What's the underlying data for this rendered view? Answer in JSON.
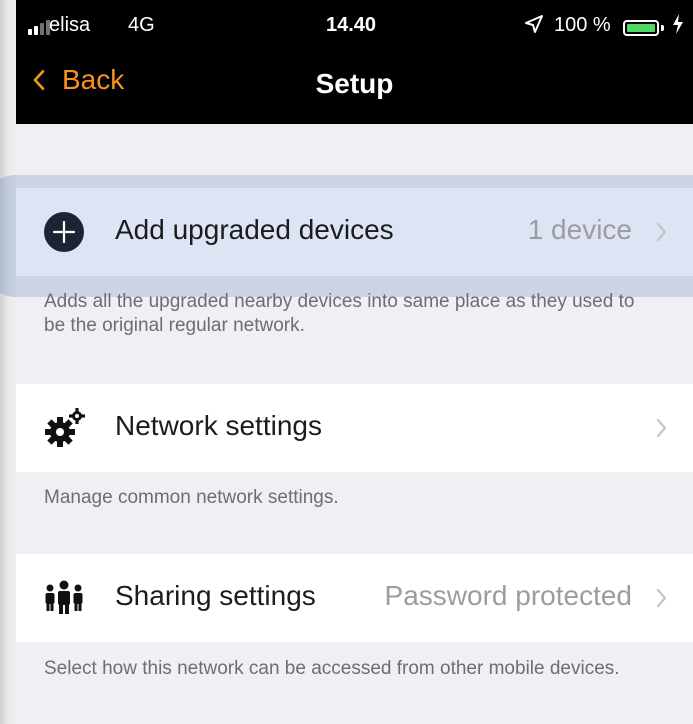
{
  "status_bar": {
    "carrier": "elisa",
    "network": "4G",
    "time": "14.40",
    "battery": "100 %",
    "battery_color": "#4cd964"
  },
  "nav": {
    "back_label": "Back",
    "title": "Setup",
    "accent_color": "#f7931e"
  },
  "sections": [
    {
      "icon": "plus-circle-icon",
      "label": "Add upgraded devices",
      "value": "1 device",
      "footer": "Adds all the upgraded nearby devices into same place as they used to be the original regular network."
    },
    {
      "icon": "gears-icon",
      "label": "Network settings",
      "value": "",
      "footer": "Manage common network settings."
    },
    {
      "icon": "people-icon",
      "label": "Sharing settings",
      "value": "Password protected",
      "footer": "Select how this network can be accessed from other mobile devices."
    }
  ]
}
